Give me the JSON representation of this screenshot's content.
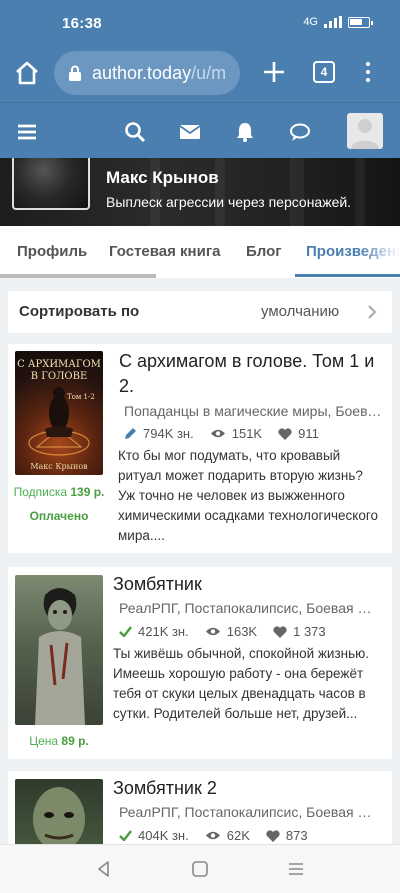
{
  "status_bar": {
    "time": "16:38",
    "network": "4G"
  },
  "browser": {
    "url_main": "author.today",
    "url_rest": "/u/m",
    "tab_count": "4"
  },
  "author": {
    "name": "Макс Крынов",
    "tagline": "Выплеск агрессии через персонажей."
  },
  "profile_tabs": [
    {
      "label": "Профиль",
      "active": false
    },
    {
      "label": "Гостевая книга",
      "active": false
    },
    {
      "label": "Блог",
      "active": false
    },
    {
      "label": "Произведения",
      "active": true
    }
  ],
  "sort": {
    "label": "Сортировать по",
    "value": "умолчанию"
  },
  "books": [
    {
      "title": "С архимагом в голове. Том 1 и 2.",
      "cover_title": "С АРХИМАГОМ В ГОЛОВЕ",
      "cover_volume": "Том 1-2",
      "cover_author": "Макс Крынов",
      "genres": "Попаданцы в магические миры, Боевое фэнтези",
      "chars": "794K зн.",
      "views": "151K",
      "likes": "911",
      "price_label": "Подписка",
      "price_value": "139 р.",
      "status": "Оплачено",
      "blurb": "Кто бы мог подумать, что кровавый ритуал может подарить вторую жизнь? Уж точно не человек из выжженного химическими осадками технологического мира...."
    },
    {
      "title": "Зомбятник",
      "genres": "РеалРПГ, Постапокалипсис, Боевая фантастика",
      "chars": "421K зн.",
      "views": "163K",
      "likes": "1 373",
      "price_label": "Цена",
      "price_value": "89 р.",
      "blurb": "Ты живёшь обычной, спокойной жизнью. Имеешь хорошую работу - она бережёт тебя от скуки целых двенадцать часов в сутки. Родителей больше нет, друзей..."
    },
    {
      "title": "Зомбятник 2",
      "genres": "РеалРПГ, Постапокалипсис, Боевая фантастика",
      "chars": "404K зн.",
      "views": "62K",
      "likes": "873"
    }
  ],
  "colors": {
    "primary": "#4a7fb0",
    "green": "#4a9d3f",
    "text": "#222222"
  }
}
